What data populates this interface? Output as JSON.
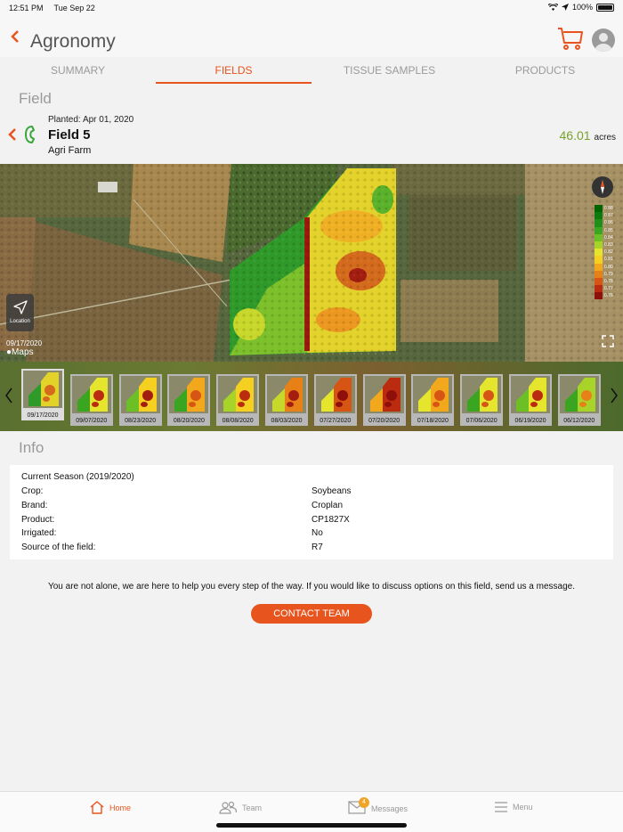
{
  "status": {
    "time": "12:51 PM",
    "date": "Tue Sep 22",
    "battery": "100%"
  },
  "header": {
    "title": "Agronomy"
  },
  "tabs": [
    {
      "label": "SUMMARY"
    },
    {
      "label": "FIELDS"
    },
    {
      "label": "TISSUE SAMPLES"
    },
    {
      "label": "PRODUCTS"
    }
  ],
  "field_section": {
    "title": "Field"
  },
  "field": {
    "planted_label": "Planted:",
    "planted_date": "Apr 01, 2020",
    "name": "Field 5",
    "farm": "Agri Farm",
    "acres_value": "46.01",
    "acres_unit": "acres"
  },
  "map": {
    "location_label": "Location",
    "date": "09/17/2020",
    "maps_label": "Maps",
    "legend": [
      {
        "label": "0.88",
        "color": "#006400"
      },
      {
        "label": "0.87",
        "color": "#0c7a0c"
      },
      {
        "label": "0.86",
        "color": "#1f8f1a"
      },
      {
        "label": "0.85",
        "color": "#3aa520"
      },
      {
        "label": "0.84",
        "color": "#6cbf25"
      },
      {
        "label": "0.83",
        "color": "#a8d42a"
      },
      {
        "label": "0.82",
        "color": "#e5e52e"
      },
      {
        "label": "0.81",
        "color": "#f5d020"
      },
      {
        "label": "0.80",
        "color": "#f2a81c"
      },
      {
        "label": "0.79",
        "color": "#e88018"
      },
      {
        "label": "0.78",
        "color": "#d65414"
      },
      {
        "label": "0.77",
        "color": "#bb2b10"
      },
      {
        "label": "0.76",
        "color": "#8f0f0a"
      }
    ]
  },
  "timeline": [
    {
      "date": "09/17/2020"
    },
    {
      "date": "09/07/2020"
    },
    {
      "date": "08/23/2020"
    },
    {
      "date": "08/20/2020"
    },
    {
      "date": "08/08/2020"
    },
    {
      "date": "08/03/2020"
    },
    {
      "date": "07/27/2020"
    },
    {
      "date": "07/20/2020"
    },
    {
      "date": "07/18/2020"
    },
    {
      "date": "07/06/2020"
    },
    {
      "date": "06/19/2020"
    },
    {
      "date": "06/12/2020"
    }
  ],
  "info_section": {
    "title": "Info"
  },
  "info": {
    "season": "Current Season (2019/2020)",
    "rows": [
      {
        "label": "Crop:",
        "value": "Soybeans"
      },
      {
        "label": "Brand:",
        "value": "Croplan"
      },
      {
        "label": "Product:",
        "value": "CP1827X"
      },
      {
        "label": "Irrigated:",
        "value": "No"
      },
      {
        "label": "Source of the field:",
        "value": "R7"
      }
    ]
  },
  "help_text": "You are not alone, we are here to help you every step of the way. If you would like to discuss options on this field, send us a message.",
  "contact_button": "CONTACT TEAM",
  "nav": {
    "home": "Home",
    "team": "Team",
    "messages": "Messages",
    "messages_badge": "4",
    "menu": "Menu"
  },
  "colors": {
    "accent": "#e8541e",
    "acres": "#7aa12c"
  }
}
